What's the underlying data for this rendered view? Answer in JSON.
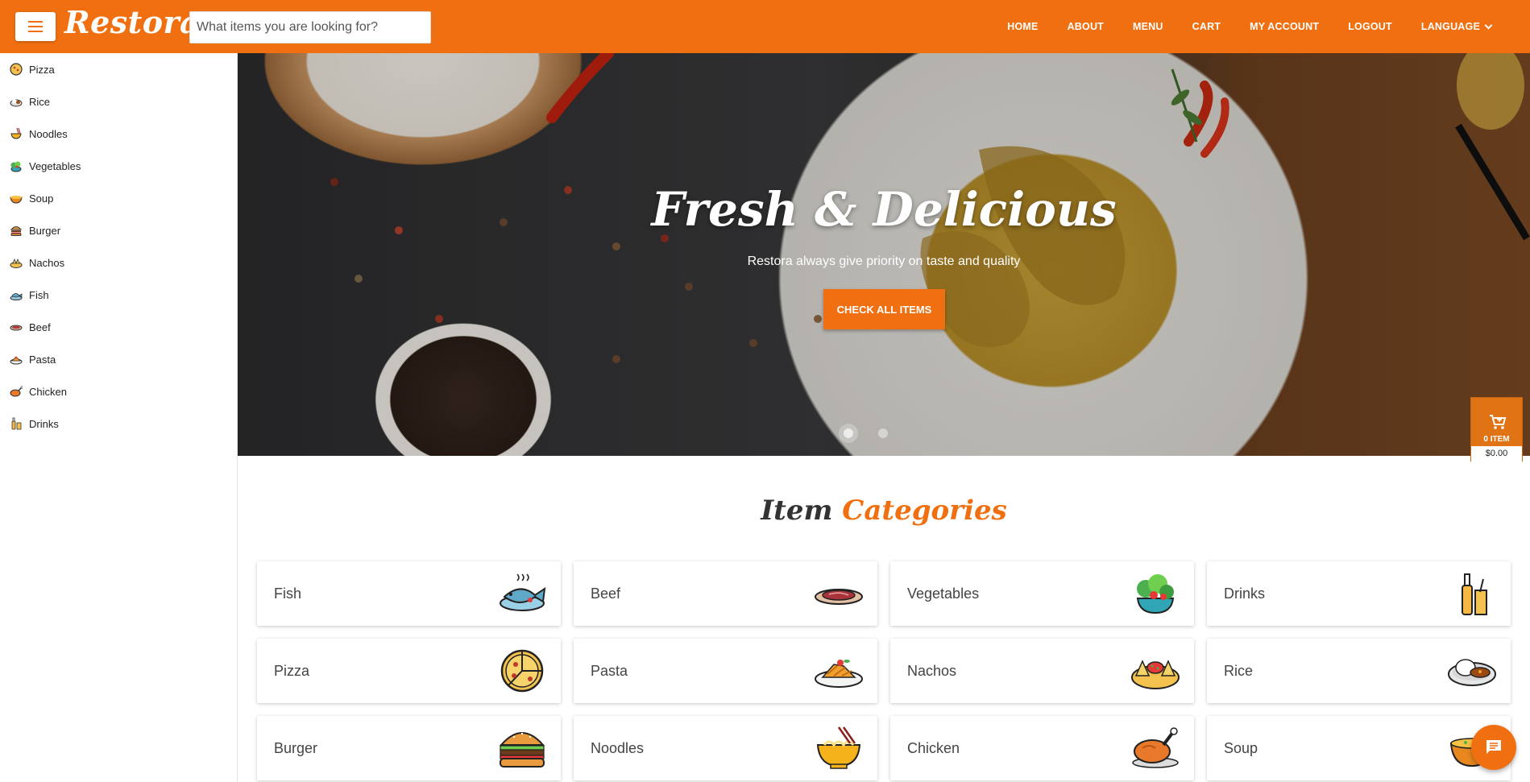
{
  "header": {
    "logo": "Restora",
    "search_placeholder": "What items you are looking for?",
    "nav": [
      {
        "label": "HOME"
      },
      {
        "label": "ABOUT"
      },
      {
        "label": "MENU"
      },
      {
        "label": "CART"
      },
      {
        "label": "MY ACCOUNT"
      },
      {
        "label": "LOGOUT"
      },
      {
        "label": "LANGUAGE"
      }
    ]
  },
  "sidebar": {
    "items": [
      {
        "label": "Pizza",
        "icon": "pizza-icon"
      },
      {
        "label": "Rice",
        "icon": "rice-icon"
      },
      {
        "label": "Noodles",
        "icon": "noodles-icon"
      },
      {
        "label": "Vegetables",
        "icon": "vegetables-icon"
      },
      {
        "label": "Soup",
        "icon": "soup-icon"
      },
      {
        "label": "Burger",
        "icon": "burger-icon"
      },
      {
        "label": "Nachos",
        "icon": "nachos-icon"
      },
      {
        "label": "Fish",
        "icon": "fish-icon"
      },
      {
        "label": "Beef",
        "icon": "beef-icon"
      },
      {
        "label": "Pasta",
        "icon": "pasta-icon"
      },
      {
        "label": "Chicken",
        "icon": "chicken-icon"
      },
      {
        "label": "Drinks",
        "icon": "drinks-icon"
      }
    ]
  },
  "hero": {
    "title": "Fresh & Delicious",
    "subtitle": "Restora always give priority on taste and quality",
    "button": "CHECK ALL ITEMS"
  },
  "cart": {
    "count": "0 ITEM",
    "total": "$0.00"
  },
  "categories": {
    "title_part1": "Item",
    "title_part2": "Categories",
    "items": [
      {
        "label": "Fish",
        "icon": "fish-icon"
      },
      {
        "label": "Beef",
        "icon": "beef-icon"
      },
      {
        "label": "Vegetables",
        "icon": "vegetables-icon"
      },
      {
        "label": "Drinks",
        "icon": "drinks-icon"
      },
      {
        "label": "Pizza",
        "icon": "pizza-icon"
      },
      {
        "label": "Pasta",
        "icon": "pasta-icon"
      },
      {
        "label": "Nachos",
        "icon": "nachos-icon"
      },
      {
        "label": "Rice",
        "icon": "rice-icon"
      },
      {
        "label": "Burger",
        "icon": "burger-icon"
      },
      {
        "label": "Noodles",
        "icon": "noodles-icon"
      },
      {
        "label": "Chicken",
        "icon": "chicken-icon"
      },
      {
        "label": "Soup",
        "icon": "soup-icon"
      }
    ]
  },
  "colors": {
    "brand": "#f07011"
  }
}
